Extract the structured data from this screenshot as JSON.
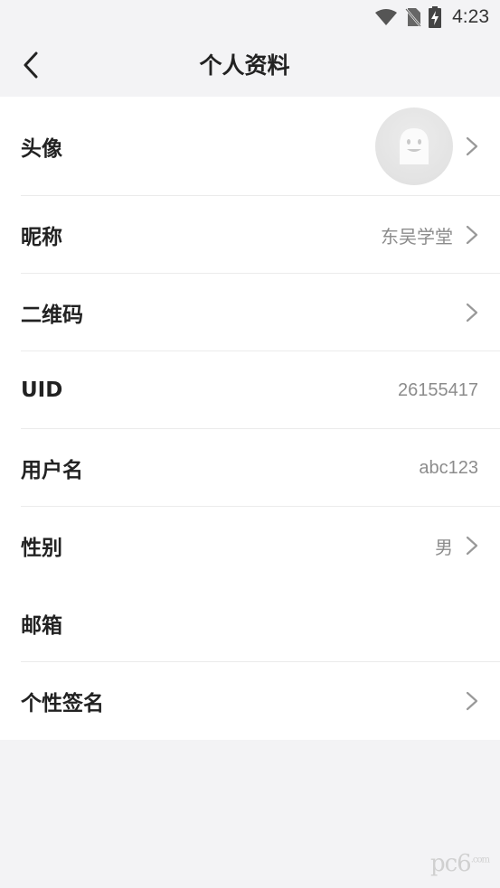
{
  "status": {
    "time": "4:23",
    "icons": [
      "wifi-icon",
      "no-sim-icon",
      "battery-charging-icon"
    ]
  },
  "header": {
    "back_icon": "chevron-left-icon",
    "title": "个人资料"
  },
  "rows": [
    {
      "label": "头像",
      "value": "",
      "has_chevron": true,
      "type": "avatar",
      "avatar_icon": "ghost-avatar-icon"
    },
    {
      "label": "昵称",
      "value": "东吴学堂",
      "has_chevron": true
    },
    {
      "label": "二维码",
      "value": "",
      "has_chevron": true
    },
    {
      "label": "UID",
      "value": "26155417",
      "has_chevron": false
    },
    {
      "label": "用户名",
      "value": "abc123",
      "has_chevron": false
    },
    {
      "label": "性别",
      "value": "男",
      "has_chevron": true
    },
    {
      "label": "邮箱",
      "value": "",
      "has_chevron": false
    },
    {
      "label": "个性签名",
      "value": "",
      "has_chevron": true
    }
  ],
  "colors": {
    "background": "#f3f3f5",
    "card": "#ffffff",
    "label": "#222222",
    "value": "#8c8c8c",
    "divider": "#ebebeb"
  },
  "watermark": {
    "text": "pc6",
    "suffix": ".com"
  }
}
